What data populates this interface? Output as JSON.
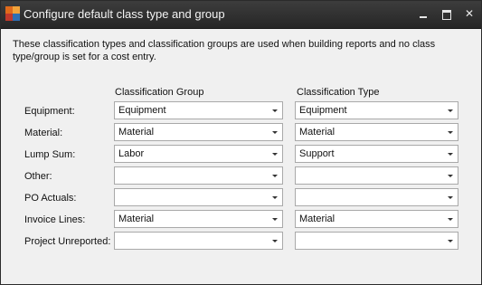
{
  "window": {
    "title": "Configure default class type and group"
  },
  "description": "These classification types and classification groups are used when building reports and no class type/group is set for a cost entry.",
  "columns": {
    "group": "Classification Group",
    "type": "Classification Type"
  },
  "rows": [
    {
      "label": "Equipment:",
      "group": "Equipment",
      "type": "Equipment"
    },
    {
      "label": "Material:",
      "group": "Material",
      "type": "Material"
    },
    {
      "label": "Lump Sum:",
      "group": "Labor",
      "type": "Support"
    },
    {
      "label": "Other:",
      "group": "",
      "type": ""
    },
    {
      "label": "PO Actuals:",
      "group": "",
      "type": ""
    },
    {
      "label": "Invoice Lines:",
      "group": "Material",
      "type": "Material"
    },
    {
      "label": "Project Unreported:",
      "group": "",
      "type": ""
    }
  ],
  "icons": {
    "app": "app-logo-icon",
    "minimize": "minimize-icon",
    "maximize": "maximize-icon",
    "close": "close-icon",
    "dropdown": "chevron-down-icon"
  }
}
